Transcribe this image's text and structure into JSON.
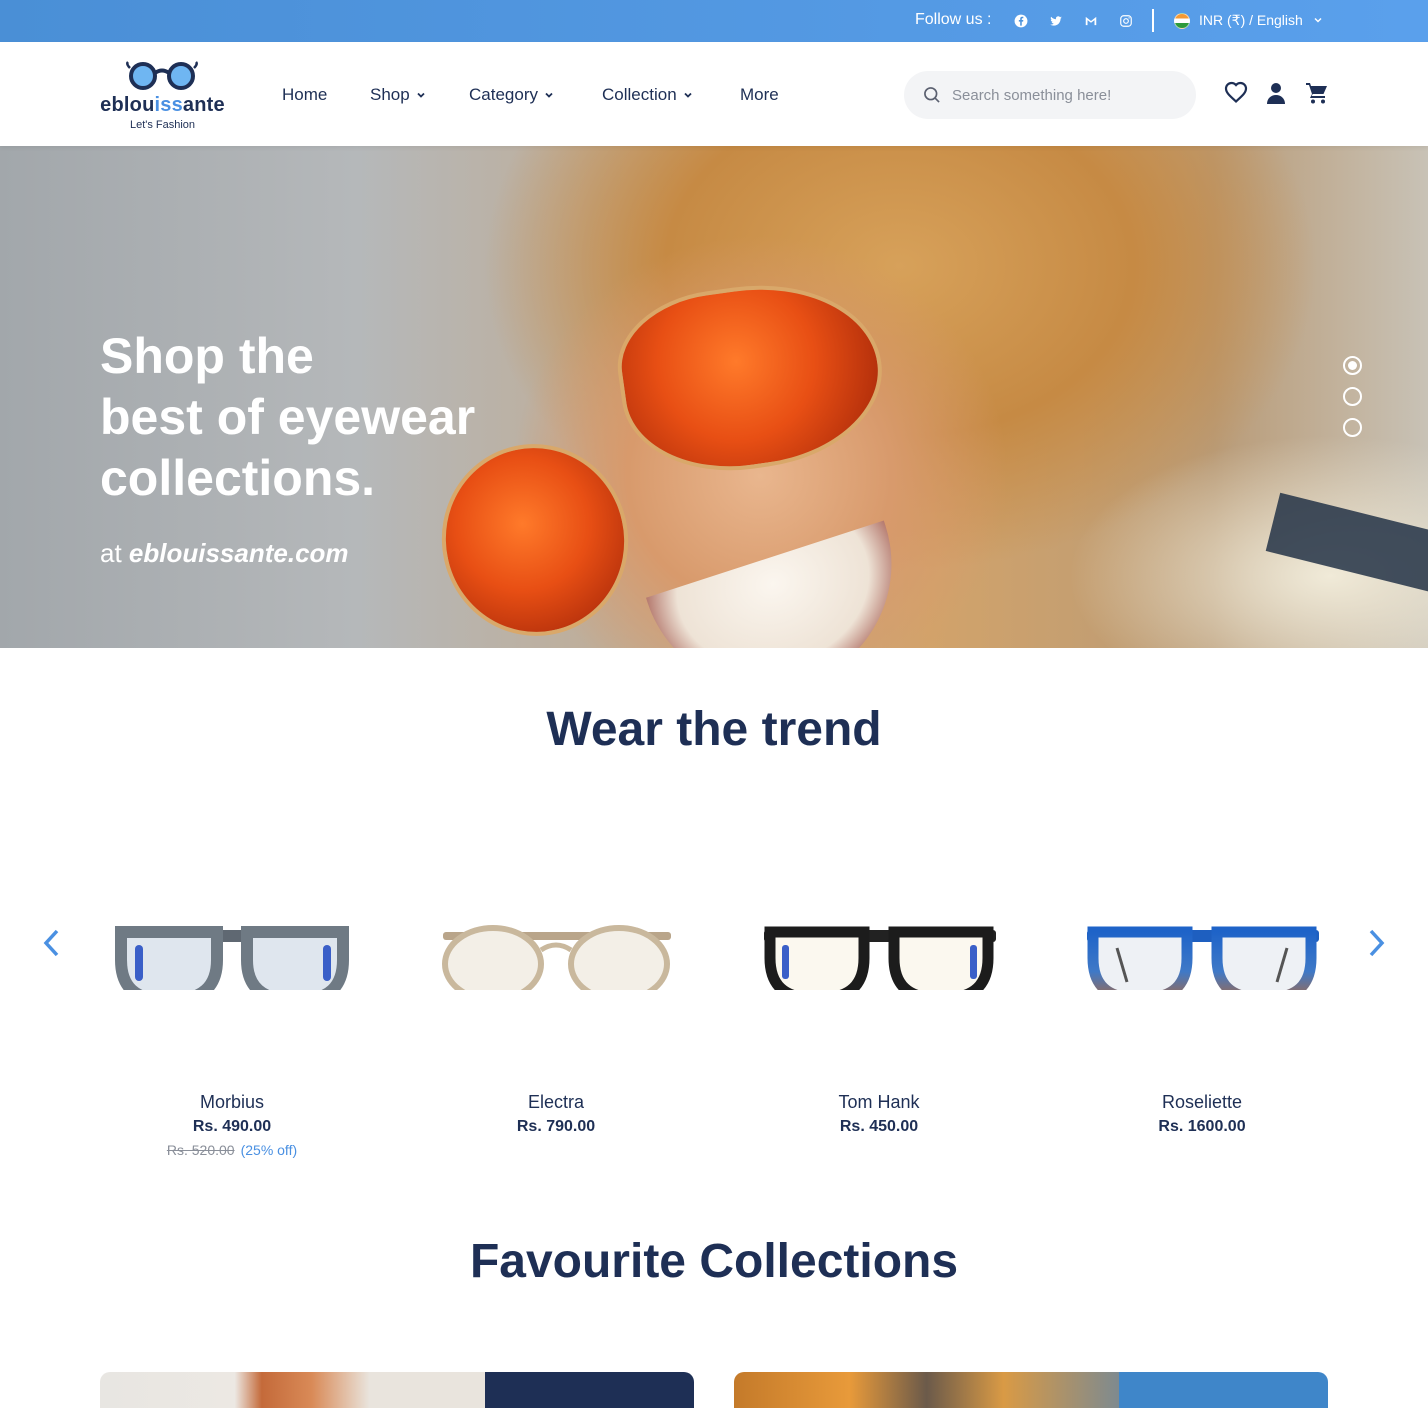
{
  "topbar": {
    "follow_label": "Follow us :",
    "social_icons": [
      "facebook-icon",
      "twitter-icon",
      "gmail-icon",
      "instagram-icon"
    ],
    "locale_label": "INR (₹) / English"
  },
  "brand": {
    "name_part1": "eblou",
    "name_highlight": "iss",
    "name_part2": "ante",
    "tagline": "Let's Fashion"
  },
  "nav": {
    "items": [
      {
        "label": "Home",
        "dropdown": false
      },
      {
        "label": "Shop",
        "dropdown": true
      },
      {
        "label": "Category",
        "dropdown": true
      },
      {
        "label": "Collection",
        "dropdown": true
      },
      {
        "label": "More",
        "dropdown": false
      }
    ]
  },
  "search": {
    "placeholder": "Search something here!",
    "value": ""
  },
  "header_icons": [
    "heart-icon",
    "user-icon",
    "cart-icon"
  ],
  "hero": {
    "line1": "Shop the",
    "line2": "best of eyewear",
    "line3": "collections.",
    "sub_prefix": "at ",
    "sub_site": "eblouissante.com",
    "slides": 3,
    "active_slide": 1
  },
  "trend": {
    "title": "Wear the trend",
    "products": [
      {
        "name": "Morbius",
        "price": "Rs. 490.00",
        "old_price": "Rs. 520.00",
        "discount": "(25% off)"
      },
      {
        "name": "Electra",
        "price": "Rs. 790.00"
      },
      {
        "name": "Tom Hank",
        "price": "Rs. 450.00"
      },
      {
        "name": "Roseliette",
        "price": "Rs. 1600.00"
      }
    ]
  },
  "favourites": {
    "title": "Favourite Collections"
  },
  "colors": {
    "brand_navy": "#1e2f55",
    "accent_blue": "#4a90e2",
    "topbar_start": "#4a8fd6",
    "topbar_end": "#5aa0ec"
  }
}
